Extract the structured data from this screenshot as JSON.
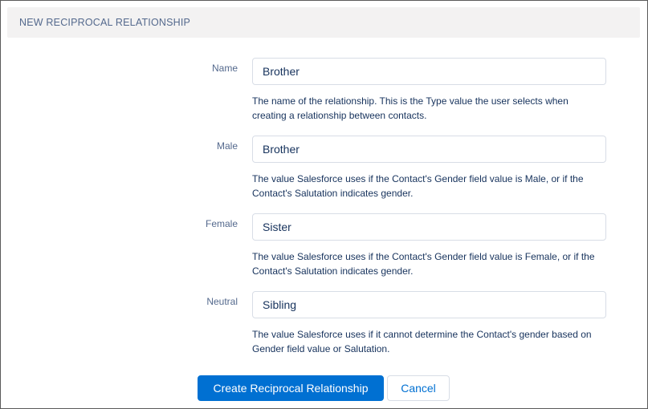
{
  "section": {
    "title": "NEW RECIPROCAL RELATIONSHIP"
  },
  "fields": [
    {
      "label": "Name",
      "value": "Brother",
      "help_line1": "The name of the relationship. This is the Type value the user selects when",
      "help_line2": "creating a relationship between contacts."
    },
    {
      "label": "Male",
      "value": "Brother",
      "help_line1": "The value Salesforce uses if the Contact's Gender field value is Male, or if the",
      "help_line2": "Contact's Salutation indicates gender."
    },
    {
      "label": "Female",
      "value": "Sister",
      "help_line1": "The value Salesforce uses if the Contact's Gender field value is Female, or if the",
      "help_line2": "Contact's Salutation indicates gender."
    },
    {
      "label": "Neutral",
      "value": "Sibling",
      "help_line1": "The value Salesforce uses if it cannot determine the Contact's gender based on",
      "help_line2": "Gender field value or Salutation."
    }
  ],
  "buttons": {
    "create_label": "Create Reciprocal Relationship",
    "cancel_label": "Cancel"
  },
  "colors": {
    "primary": "#0070d2",
    "label": "#54698d",
    "text": "#16325c",
    "header_bg": "#f3f2f2"
  }
}
